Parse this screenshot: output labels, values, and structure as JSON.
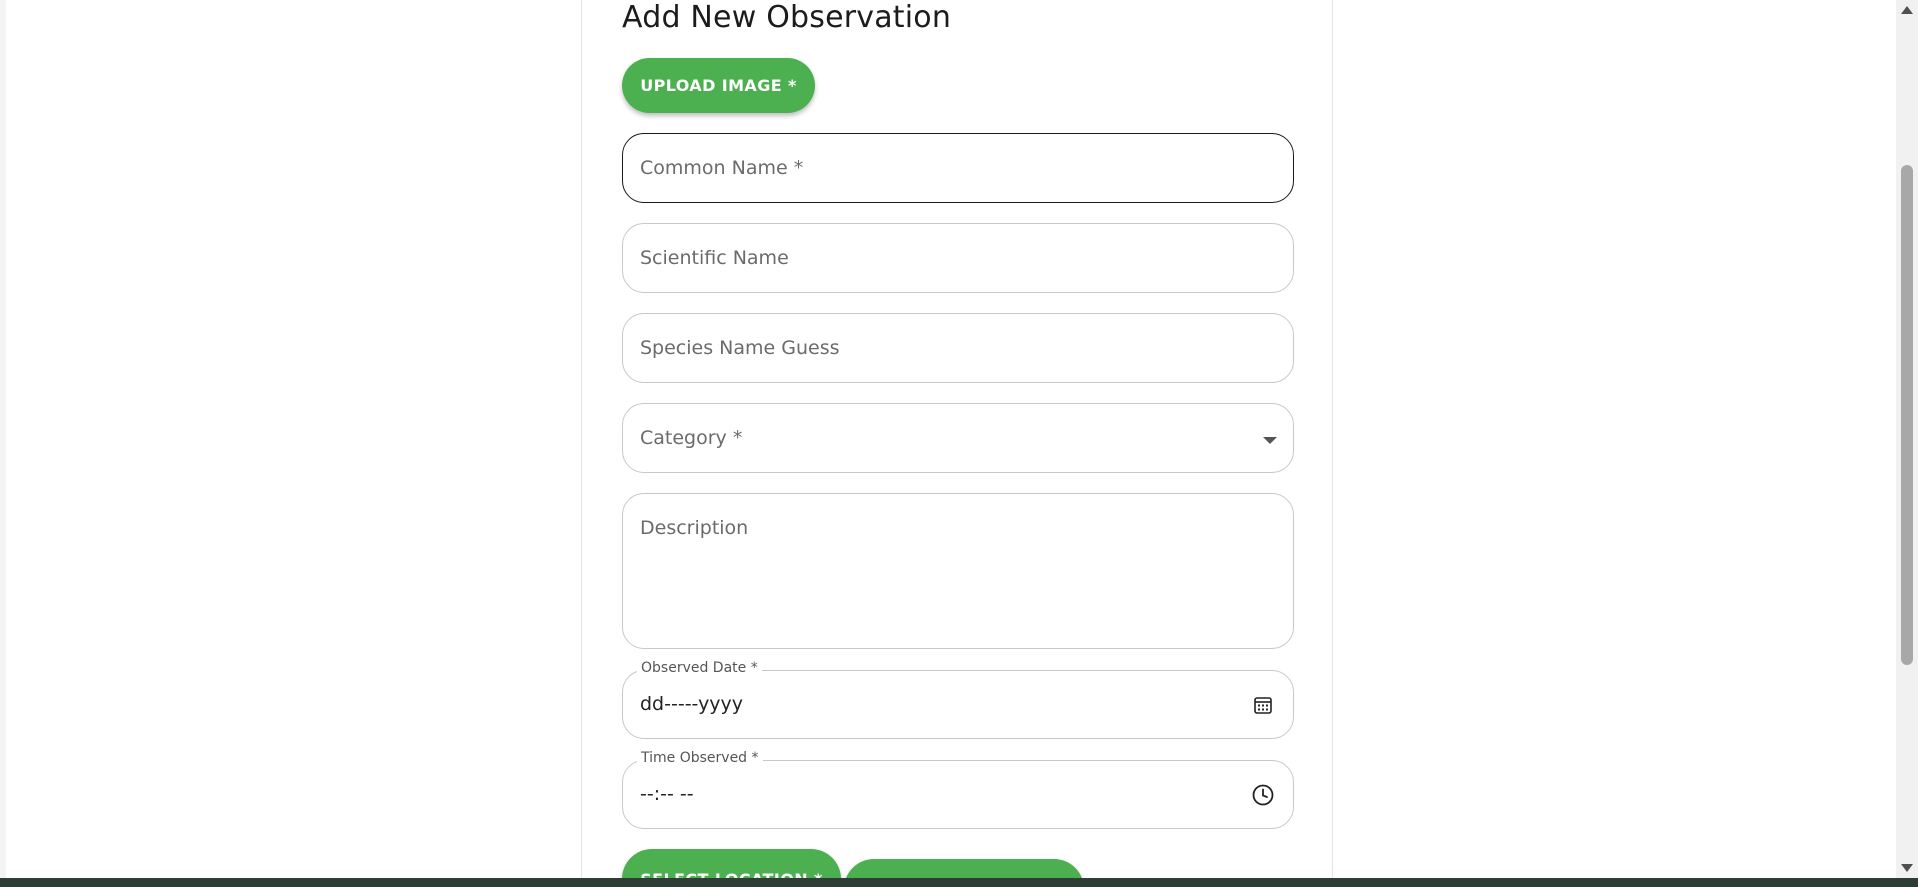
{
  "page": {
    "title": "Add New Observation"
  },
  "buttons": {
    "upload_image": "UPLOAD IMAGE *",
    "select_location": "SELECT LOCATION *"
  },
  "fields": {
    "common_name": {
      "placeholder": "Common Name *"
    },
    "scientific_name": {
      "placeholder": "Scientific Name"
    },
    "species_name_guess": {
      "placeholder": "Species Name Guess"
    },
    "category": {
      "placeholder": "Category *"
    },
    "description": {
      "placeholder": "Description"
    },
    "observed_date": {
      "label": "Observed Date *",
      "value": "dd-----yyyy"
    },
    "time_observed": {
      "label": "Time Observed *",
      "value": "--:-- --"
    }
  },
  "colors": {
    "accent": "#4caf50",
    "border": "#c8c8c8",
    "focused_border": "#1a1a1a"
  },
  "icons": {
    "date": "calendar-icon",
    "time": "clock-icon",
    "dropdown": "chevron-down-icon"
  }
}
